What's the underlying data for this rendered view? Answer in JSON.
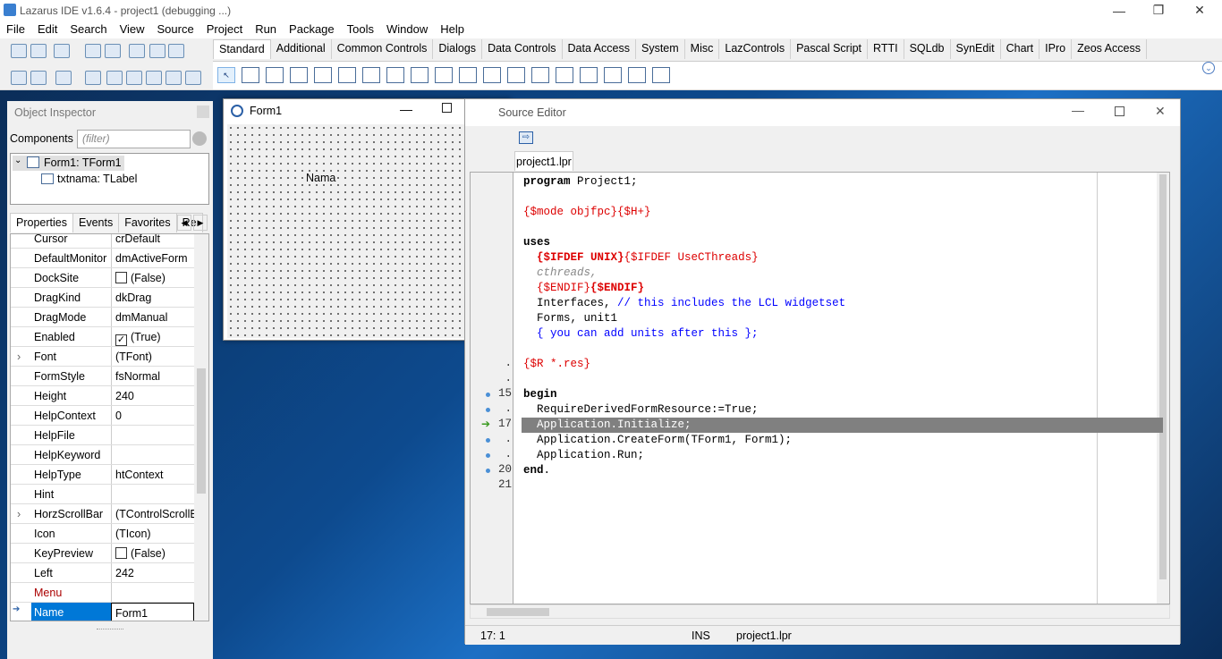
{
  "main": {
    "title": "Lazarus IDE v1.6.4 - project1 (debugging ...)",
    "menu": [
      "File",
      "Edit",
      "Search",
      "View",
      "Source",
      "Project",
      "Run",
      "Package",
      "Tools",
      "Window",
      "Help"
    ],
    "palette_tabs": [
      "Standard",
      "Additional",
      "Common Controls",
      "Dialogs",
      "Data Controls",
      "Data Access",
      "System",
      "Misc",
      "LazControls",
      "Pascal Script",
      "RTTI",
      "SQLdb",
      "SynEdit",
      "Chart",
      "IPro",
      "Zeos Access"
    ],
    "palette_icons": [
      "arrow",
      "TMainMenu",
      "TPopupMenu",
      "TButton",
      "TLabel",
      "TEdit",
      "TMemo",
      "TToggleBox",
      "TCheckBox",
      "TRadioButton",
      "TListBox",
      "TComboBox",
      "TScrollBar",
      "TGroupBox",
      "TRadioGroup",
      "TCheckGroup",
      "TPanel",
      "TFrame",
      "TActionList"
    ]
  },
  "inspector": {
    "title": "Object Inspector",
    "components_label": "Components",
    "filter_placeholder": "(filter)",
    "tree": [
      "Form1: TForm1",
      "txtnama: TLabel"
    ],
    "tabs": [
      "Properties",
      "Events",
      "Favorites",
      "Re"
    ],
    "props": [
      {
        "name": "Cursor",
        "value": "crDefault"
      },
      {
        "name": "DefaultMonitor",
        "value": "dmActiveForm"
      },
      {
        "name": "DockSite",
        "value": "(False)",
        "check": " "
      },
      {
        "name": "DragKind",
        "value": "dkDrag"
      },
      {
        "name": "DragMode",
        "value": "dmManual"
      },
      {
        "name": "Enabled",
        "value": "(True)",
        "check": "✓"
      },
      {
        "name": "Font",
        "value": "(TFont)",
        "expand": true
      },
      {
        "name": "FormStyle",
        "value": "fsNormal"
      },
      {
        "name": "Height",
        "value": "240"
      },
      {
        "name": "HelpContext",
        "value": "0"
      },
      {
        "name": "HelpFile",
        "value": ""
      },
      {
        "name": "HelpKeyword",
        "value": ""
      },
      {
        "name": "HelpType",
        "value": "htContext"
      },
      {
        "name": "Hint",
        "value": ""
      },
      {
        "name": "HorzScrollBar",
        "value": "(TControlScrollBa",
        "expand": true
      },
      {
        "name": "Icon",
        "value": "(TIcon)"
      },
      {
        "name": "KeyPreview",
        "value": "(False)",
        "check": " "
      },
      {
        "name": "Left",
        "value": "242"
      },
      {
        "name": "Menu",
        "value": "",
        "red": true
      },
      {
        "name": "Name",
        "value": "Form1",
        "selected": true
      }
    ]
  },
  "form1": {
    "title": "Form1",
    "label": "Nama"
  },
  "editor": {
    "title": "Source Editor",
    "tab": "project1.lpr",
    "status": {
      "pos": "17:  1",
      "mode": "INS",
      "file": "project1.lpr"
    },
    "lines": [
      {
        "n": "",
        "html": "<span class='kw'>program</span> Project1;"
      },
      {
        "n": "",
        "html": ""
      },
      {
        "n": "",
        "html": "<span class='dir'>{$mode objfpc}{$H+}</span>"
      },
      {
        "n": "",
        "html": ""
      },
      {
        "n": "",
        "html": "<span class='kw'>uses</span>"
      },
      {
        "n": "",
        "html": "  <span class='dir'><b>{$IFDEF UNIX}</b>{$IFDEF UseCThreads}</span>"
      },
      {
        "n": "",
        "html": "  <span style='color:#888;font-style:italic'>cthreads,</span>"
      },
      {
        "n": "",
        "html": "  <span class='dir'>{$ENDIF}<b>{$ENDIF}</b></span>"
      },
      {
        "n": "",
        "html": "  Interfaces, <span class='cm'>// this includes the LCL widgetset</span>"
      },
      {
        "n": "",
        "html": "  Forms, unit1"
      },
      {
        "n": "",
        "html": "  <span class='cm'>{ you can add units after this };</span>"
      },
      {
        "n": "",
        "html": ""
      },
      {
        "n": "",
        "html": "<span class='dir'>{$R *.res}</span>"
      },
      {
        "n": "",
        "html": ""
      },
      {
        "n": "15",
        "html": "<span class='kw'>begin</span>"
      },
      {
        "n": ".",
        "html": "  RequireDerivedFormResource:=True;"
      },
      {
        "n": "17",
        "html": "  Application.Initialize;",
        "hl": true
      },
      {
        "n": ".",
        "html": "  Application.CreateForm(TForm1, Form1);"
      },
      {
        "n": ".",
        "html": "  Application.Run;"
      },
      {
        "n": "20",
        "html": "<span class='kw'>end</span>."
      },
      {
        "n": "21",
        "html": ""
      }
    ]
  }
}
